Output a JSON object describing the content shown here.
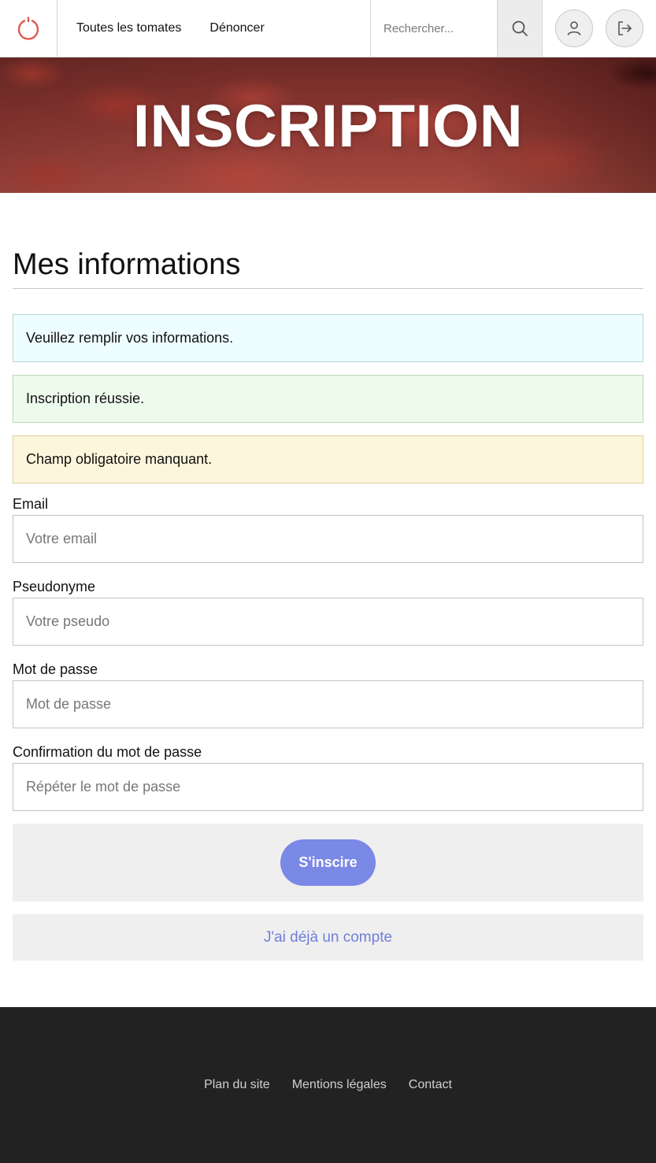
{
  "header": {
    "logo_icon": "power-icon",
    "nav": [
      {
        "label": "Toutes les tomates"
      },
      {
        "label": "Dénoncer"
      }
    ],
    "search": {
      "placeholder": "Rechercher...",
      "button_icon": "search-icon"
    },
    "actions": [
      {
        "icon": "user-icon"
      },
      {
        "icon": "logout-icon"
      }
    ],
    "accent_color": "#e05a4f"
  },
  "hero": {
    "title": "INSCRIPTION"
  },
  "main": {
    "section_title": "Mes informations",
    "alerts": [
      {
        "type": "info",
        "text": "Veuillez remplir vos informations.",
        "color": "#eefdff"
      },
      {
        "type": "success",
        "text": "Inscription réussie.",
        "color": "#edfbed"
      },
      {
        "type": "warning",
        "text": "Champ obligatoire manquant.",
        "color": "#fdf6dc"
      }
    ],
    "fields": [
      {
        "label": "Email",
        "placeholder": "Votre email",
        "value": ""
      },
      {
        "label": "Pseudonyme",
        "placeholder": "Votre pseudo",
        "value": ""
      },
      {
        "label": "Mot de passe",
        "placeholder": "Mot de passe",
        "value": ""
      },
      {
        "label": "Confirmation du mot de passe",
        "placeholder": "Répéter le mot de passe",
        "value": ""
      }
    ],
    "submit_label": "S'inscire",
    "submit_color": "#7a88e6",
    "login_link": "J'ai déjà un compte"
  },
  "footer": {
    "links": [
      {
        "label": "Plan du site"
      },
      {
        "label": "Mentions légales"
      },
      {
        "label": "Contact"
      }
    ]
  }
}
